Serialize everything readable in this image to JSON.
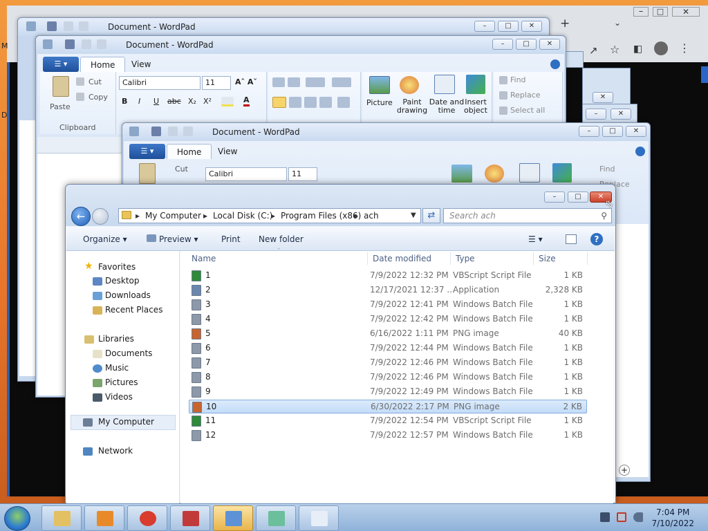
{
  "browser": {
    "new_tab": "+",
    "left_letter_top": "M",
    "left_letter_mid": "D"
  },
  "wordpad": {
    "title": "Document - WordPad",
    "tabs": [
      "Home",
      "View"
    ],
    "clipboard": {
      "paste": "Paste",
      "cut": "Cut",
      "copy": "Copy",
      "group": "Clipboard"
    },
    "font": {
      "family": "Calibri",
      "size": "11"
    },
    "insert": {
      "picture": "Picture",
      "paint": "Paint drawing",
      "datetime": "Date and time",
      "object": "Insert object"
    },
    "editing": {
      "find": "Find",
      "replace": "Replace",
      "select_all": "Select all"
    }
  },
  "explorer": {
    "breadcrumb": [
      "My Computer",
      "Local Disk (C:)",
      "Program Files (x86)",
      "ach"
    ],
    "search_placeholder": "Search ach",
    "commands": {
      "organize": "Organize",
      "preview": "Preview",
      "print": "Print",
      "new_folder": "New folder"
    },
    "nav": {
      "favorites": "Favorites",
      "favorites_items": [
        "Desktop",
        "Downloads",
        "Recent Places"
      ],
      "libraries": "Libraries",
      "libraries_items": [
        "Documents",
        "Music",
        "Pictures",
        "Videos"
      ],
      "computer": "My Computer",
      "network": "Network"
    },
    "columns": [
      "Name",
      "Date modified",
      "Type",
      "Size"
    ],
    "files": [
      {
        "name": "1",
        "date": "7/9/2022 12:32 PM",
        "type": "VBScript Script File",
        "size": "1 KB",
        "icon": "vbscript-file-icon"
      },
      {
        "name": "2",
        "date": "12/17/2021 12:37 ...",
        "type": "Application",
        "size": "2,328 KB",
        "icon": "application-icon"
      },
      {
        "name": "3",
        "date": "7/9/2022 12:41 PM",
        "type": "Windows Batch File",
        "size": "1 KB",
        "icon": "batch-file-icon"
      },
      {
        "name": "4",
        "date": "7/9/2022 12:42 PM",
        "type": "Windows Batch File",
        "size": "1 KB",
        "icon": "batch-file-icon"
      },
      {
        "name": "5",
        "date": "6/16/2022 1:11 PM",
        "type": "PNG image",
        "size": "40 KB",
        "icon": "png-image-icon"
      },
      {
        "name": "6",
        "date": "7/9/2022 12:44 PM",
        "type": "Windows Batch File",
        "size": "1 KB",
        "icon": "batch-file-icon"
      },
      {
        "name": "7",
        "date": "7/9/2022 12:46 PM",
        "type": "Windows Batch File",
        "size": "1 KB",
        "icon": "batch-file-icon"
      },
      {
        "name": "8",
        "date": "7/9/2022 12:46 PM",
        "type": "Windows Batch File",
        "size": "1 KB",
        "icon": "batch-file-icon"
      },
      {
        "name": "9",
        "date": "7/9/2022 12:49 PM",
        "type": "Windows Batch File",
        "size": "1 KB",
        "icon": "batch-file-icon"
      },
      {
        "name": "10",
        "date": "6/30/2022 2:17 PM",
        "type": "PNG image",
        "size": "2 KB",
        "icon": "png-image-icon",
        "selected": true
      },
      {
        "name": "11",
        "date": "7/9/2022 12:54 PM",
        "type": "VBScript Script File",
        "size": "1 KB",
        "icon": "vbscript-file-icon"
      },
      {
        "name": "12",
        "date": "7/9/2022 12:57 PM",
        "type": "Windows Batch File",
        "size": "1 KB",
        "icon": "batch-file-icon"
      }
    ]
  },
  "taskbar": {
    "time": "7:04 PM",
    "date": "7/10/2022",
    "buttons": [
      "file-explorer-icon",
      "media-player-icon",
      "chrome-icon",
      "app-cube-icon",
      "image-viewer-icon",
      "package-icon",
      "wordpad-icon"
    ]
  },
  "colors": {
    "selection": "#c3dcf8",
    "close_button": "#d9533c",
    "accent": "#2d5fb0"
  }
}
